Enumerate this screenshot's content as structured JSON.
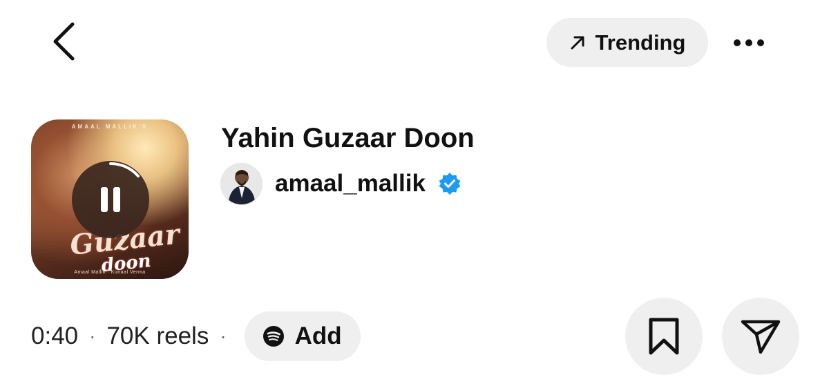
{
  "header": {
    "back_icon": "chevron-left-icon",
    "trending_label": "Trending",
    "trending_icon": "arrow-up-right-icon",
    "more_icon": "more-horizontal-icon"
  },
  "track": {
    "title": "Yahin Guzaar Doon",
    "artist": "amaal_mallik",
    "verified": true,
    "cover": {
      "top_text": "AMAAL MALLIK'S",
      "title_line1": "Guzaar",
      "title_line2": "doon",
      "credits": "Amaal Mallik · Kunaal Verma",
      "state_icon": "pause-icon"
    }
  },
  "meta": {
    "duration": "0:40",
    "separator": "·",
    "reels_count": "70K reels",
    "add_label": "Add",
    "add_icon": "spotify-icon"
  },
  "actions": {
    "save_icon": "bookmark-icon",
    "share_icon": "send-icon"
  },
  "colors": {
    "pill_bg": "#efefef",
    "verified_blue": "#1d9bf0",
    "text_primary": "#111111"
  }
}
